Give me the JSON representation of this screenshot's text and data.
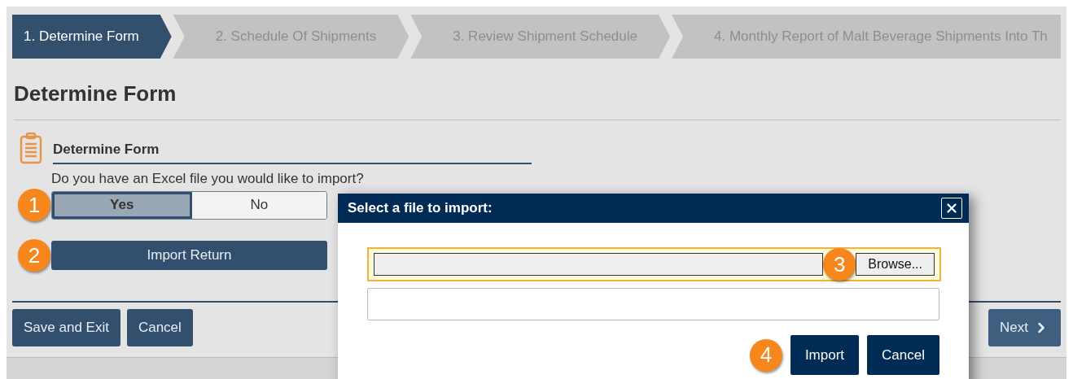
{
  "steps": [
    {
      "label": "1. Determine Form",
      "selected": true
    },
    {
      "label": "2. Schedule Of Shipments",
      "selected": false
    },
    {
      "label": "3. Review Shipment Schedule",
      "selected": false
    },
    {
      "label": "4. Monthly Report of Malt Beverage Shipments Into Th",
      "selected": false
    }
  ],
  "page_title": "Determine Form",
  "section": {
    "title": "Determine Form",
    "question": "Do you have an Excel file you would like to import?",
    "options": [
      {
        "label": "Yes",
        "selected": true
      },
      {
        "label": "No",
        "selected": false
      }
    ],
    "import_button": "Import Return"
  },
  "footer": {
    "buttons": [
      "Save and Exit",
      "Cancel"
    ],
    "next": "Next"
  },
  "dialog": {
    "title": "Select a file to import:",
    "browse_button": "Browse...",
    "buttons": [
      "Import",
      "Cancel"
    ]
  },
  "callouts": [
    "1",
    "2",
    "3",
    "4"
  ]
}
